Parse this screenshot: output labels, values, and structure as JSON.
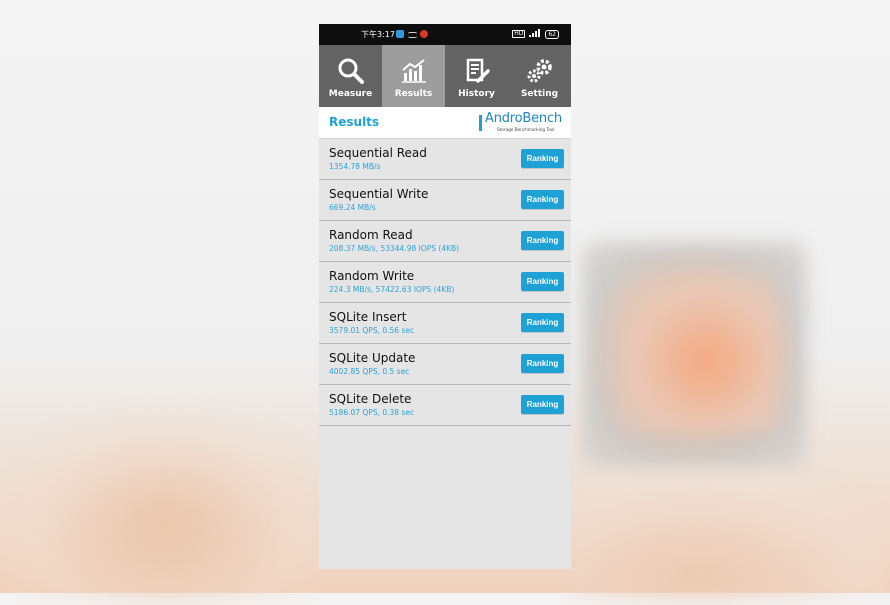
{
  "status_bar": {
    "time": "下午3:17",
    "battery": "62"
  },
  "tabs": [
    {
      "label": "Measure",
      "icon": "magnifier-icon"
    },
    {
      "label": "Results",
      "icon": "chart-icon"
    },
    {
      "label": "History",
      "icon": "document-pencil-icon"
    },
    {
      "label": "Setting",
      "icon": "gears-icon"
    }
  ],
  "header": {
    "title": "Results",
    "logo_text": "AndroBench",
    "logo_tagline": "Storage Benchmarking Tool"
  },
  "results": [
    {
      "name": "Sequential Read",
      "value": "1354.78 MB/s",
      "button": "Ranking"
    },
    {
      "name": "Sequential Write",
      "value": "669.24 MB/s",
      "button": "Ranking"
    },
    {
      "name": "Random Read",
      "value": "208.37 MB/s, 53344.98 IOPS (4KB)",
      "button": "Ranking"
    },
    {
      "name": "Random Write",
      "value": "224.3 MB/s, 57422.63 IOPS (4KB)",
      "button": "Ranking"
    },
    {
      "name": "SQLite Insert",
      "value": "3579.01 QPS, 0.56 sec",
      "button": "Ranking"
    },
    {
      "name": "SQLite Update",
      "value": "4002.85 QPS, 0.5 sec",
      "button": "Ranking"
    },
    {
      "name": "SQLite Delete",
      "value": "5186.07 QPS, 0.38 sec",
      "button": "Ranking"
    }
  ],
  "colors": {
    "accent": "#1ea2d6",
    "tab_bar": "#636363",
    "tab_active": "#9d9d9d",
    "list_bg": "#e5e5e5"
  }
}
